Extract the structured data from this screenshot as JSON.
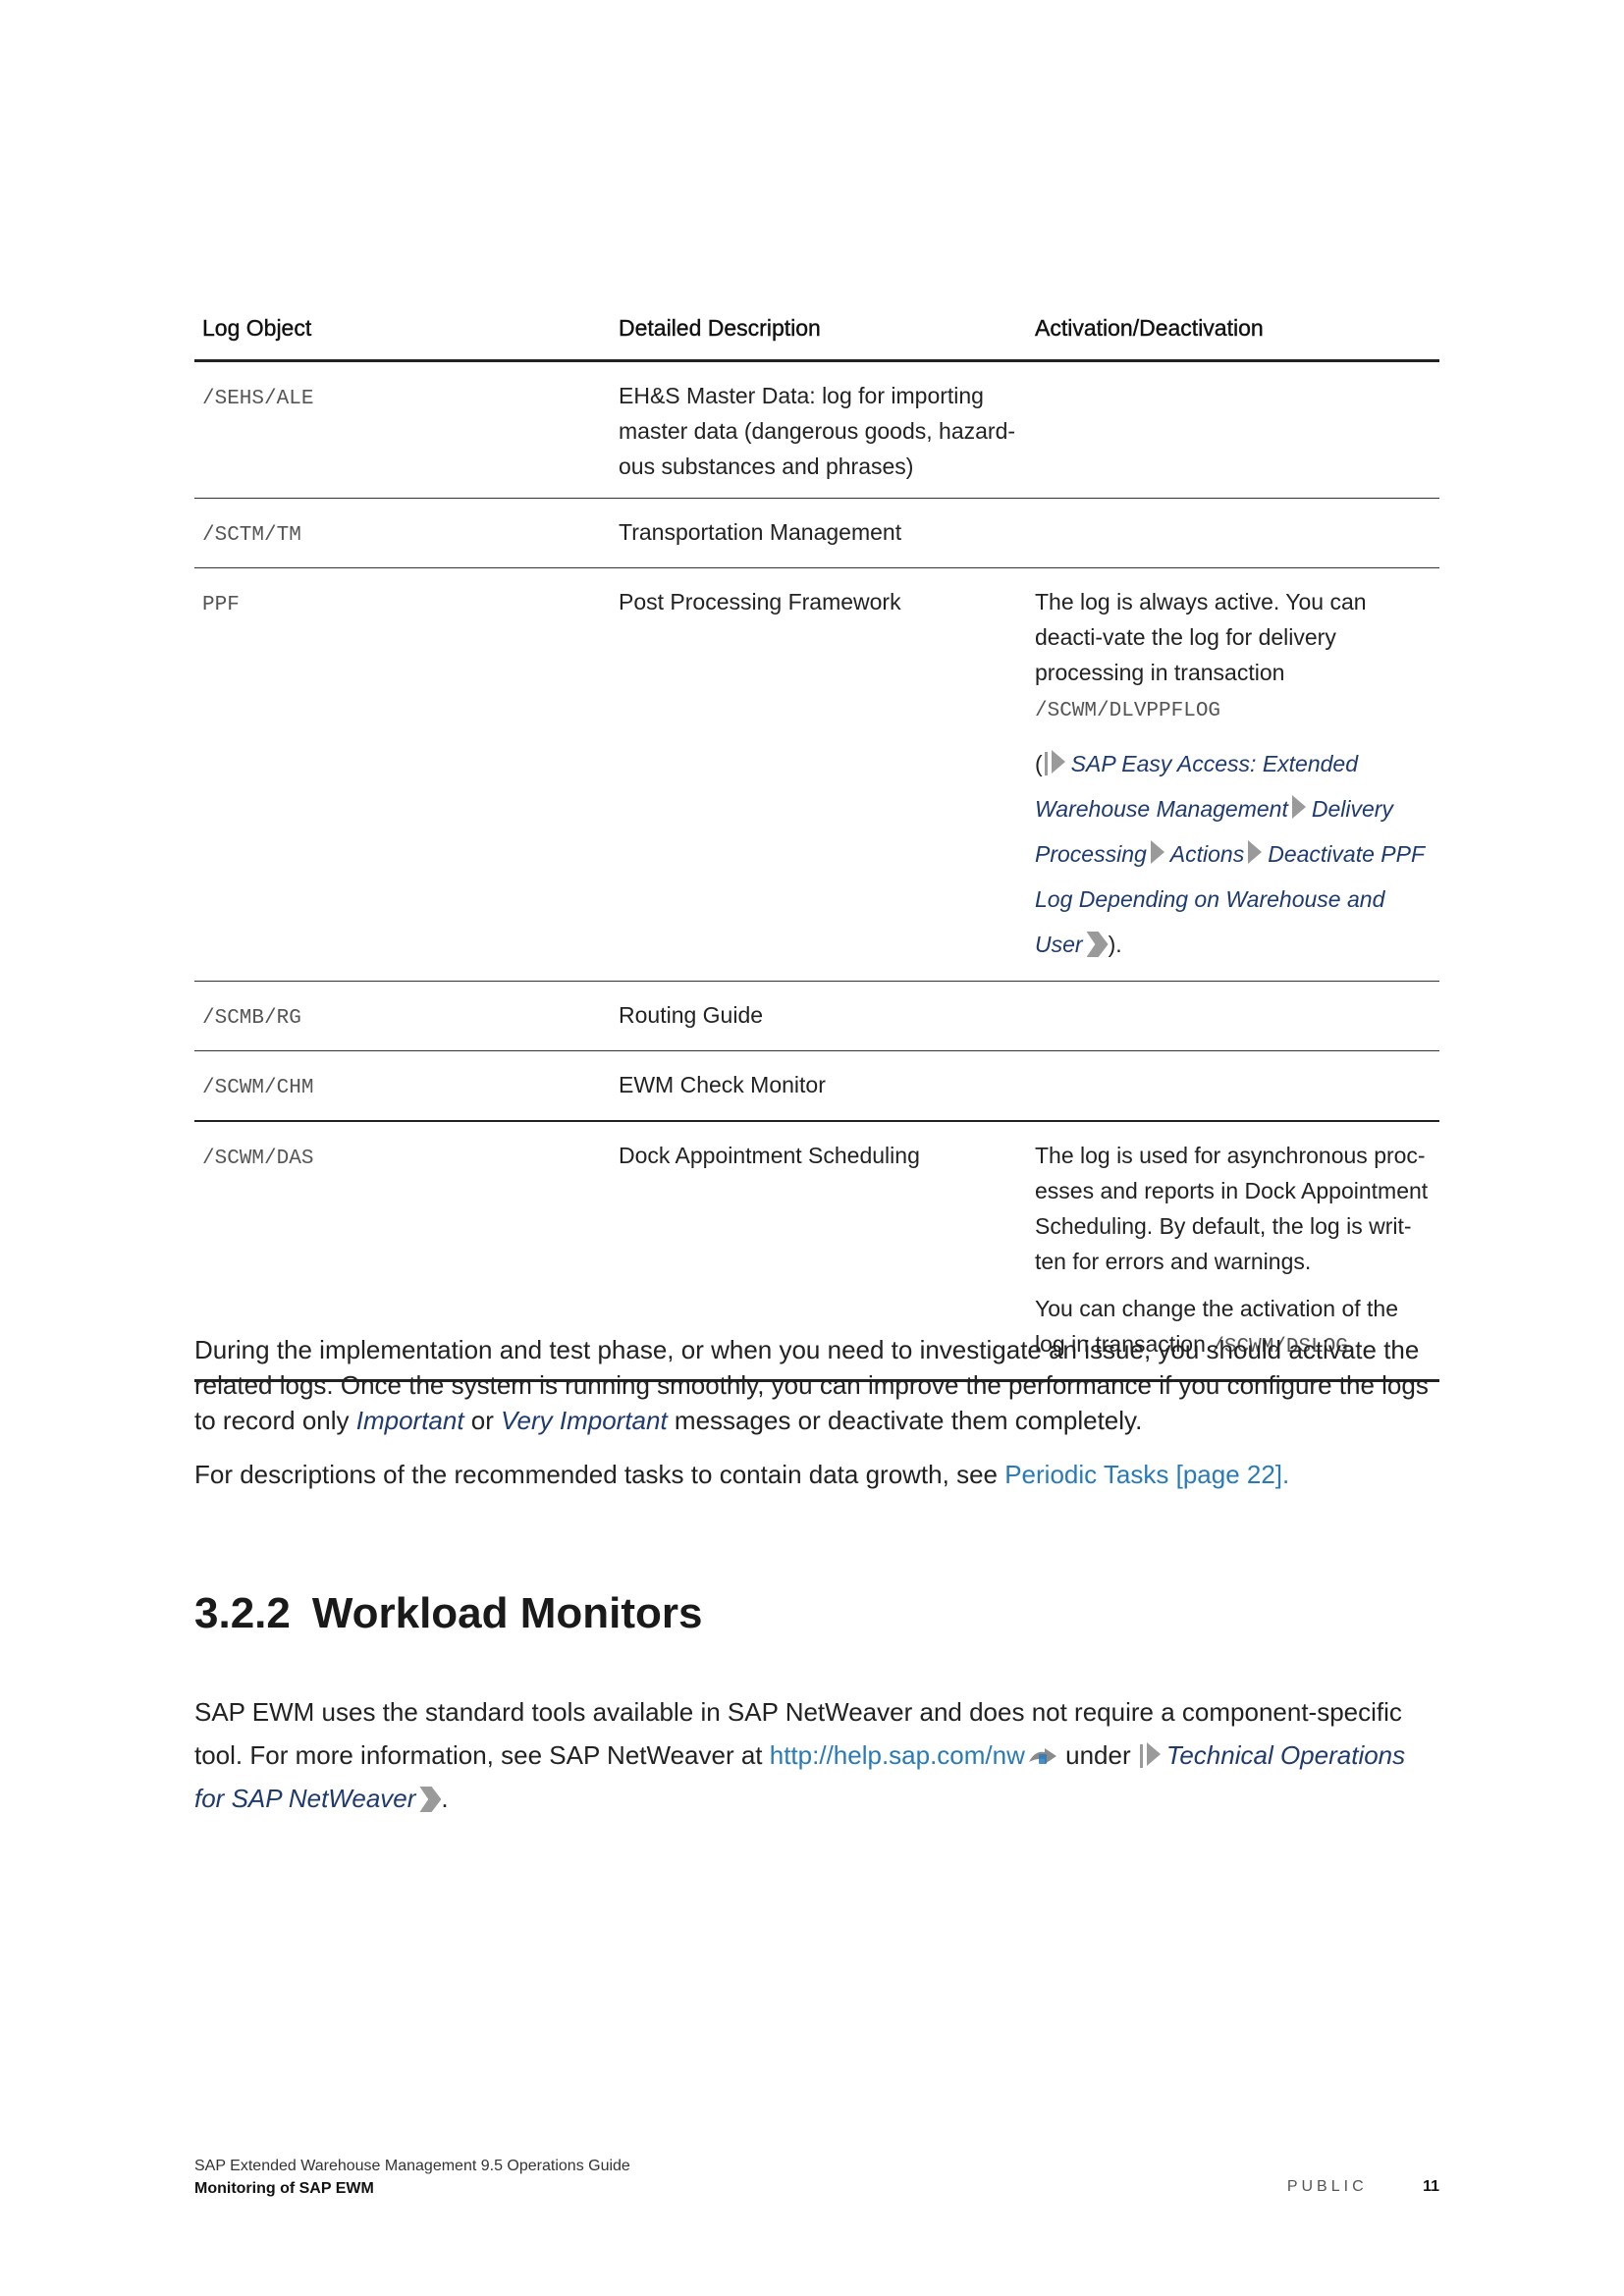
{
  "table": {
    "headers": [
      "Log Object",
      "Detailed Description",
      "Activation/Deactivation"
    ],
    "rows": [
      {
        "object": "/SEHS/ALE",
        "description": "EH&S Master Data: log for importing master data (dangerous goods, hazard-ous substances and phrases)"
      },
      {
        "object": "/SCTM/TM",
        "description": "Transportation Management"
      },
      {
        "object": "PPF",
        "description": "Post Processing Framework",
        "activation_text": "The log is always active. You can deacti-vate the log for delivery processing in transaction",
        "activation_code": "/SCWM/DLVPPFLOG",
        "path_open": "(",
        "path": [
          "SAP Easy Access: Extended Warehouse Management",
          "Delivery Processing",
          "Actions",
          "Deactivate PPF Log Depending on Warehouse and User"
        ],
        "path_close": ")."
      },
      {
        "object": "/SCMB/RG",
        "description": "Routing Guide"
      },
      {
        "object": "/SCWM/CHM",
        "description": "EWM Check Monitor"
      },
      {
        "object": "/SCWM/DAS",
        "description": "Dock Appointment Scheduling",
        "activation_p1": "The log is used for asynchronous proc-esses and reports in Dock Appointment Scheduling. By default, the log is writ-ten for errors and warnings.",
        "activation_p2": "You can change the activation of the log in transaction",
        "activation_code": "/SCWM/DSLOG",
        "activation_p2_end": "."
      }
    ]
  },
  "para1": {
    "text_a": "During the implementation and test phase, or when you need to investigate an issue, you should activate the related logs. Once the system is running smoothly, you can improve the performance if you configure the logs to record only ",
    "ital_a": "Important",
    "text_b": " or ",
    "ital_b": "Very Important",
    "text_c": " messages or deactivate them completely."
  },
  "para2": {
    "text": "For descriptions of the recommended tasks to contain data growth, see ",
    "link": "Periodic Tasks [page 22]",
    "end": "."
  },
  "section": {
    "number": "3.2.2",
    "title": "Workload Monitors"
  },
  "para3": {
    "text_a": "SAP EWM uses the standard tools available in SAP NetWeaver and does not require a component-specific tool. For more information, see SAP NetWeaver at ",
    "link": "http://help.sap.com/nw",
    "text_b": " under ",
    "path": "Technical Operations for SAP NetWeaver",
    "end": "."
  },
  "footer": {
    "title": "SAP Extended Warehouse Management 9.5 Operations Guide",
    "subtitle": "Monitoring of SAP EWM",
    "classification": "PUBLIC",
    "page": "11"
  },
  "colors": {
    "link": "#2a7ab8",
    "path": "#1f3a6e",
    "rule": "#222222"
  },
  "icons": [
    "menu-path-start-icon",
    "menu-path-separator-icon",
    "menu-path-end-icon",
    "external-link-icon"
  ]
}
